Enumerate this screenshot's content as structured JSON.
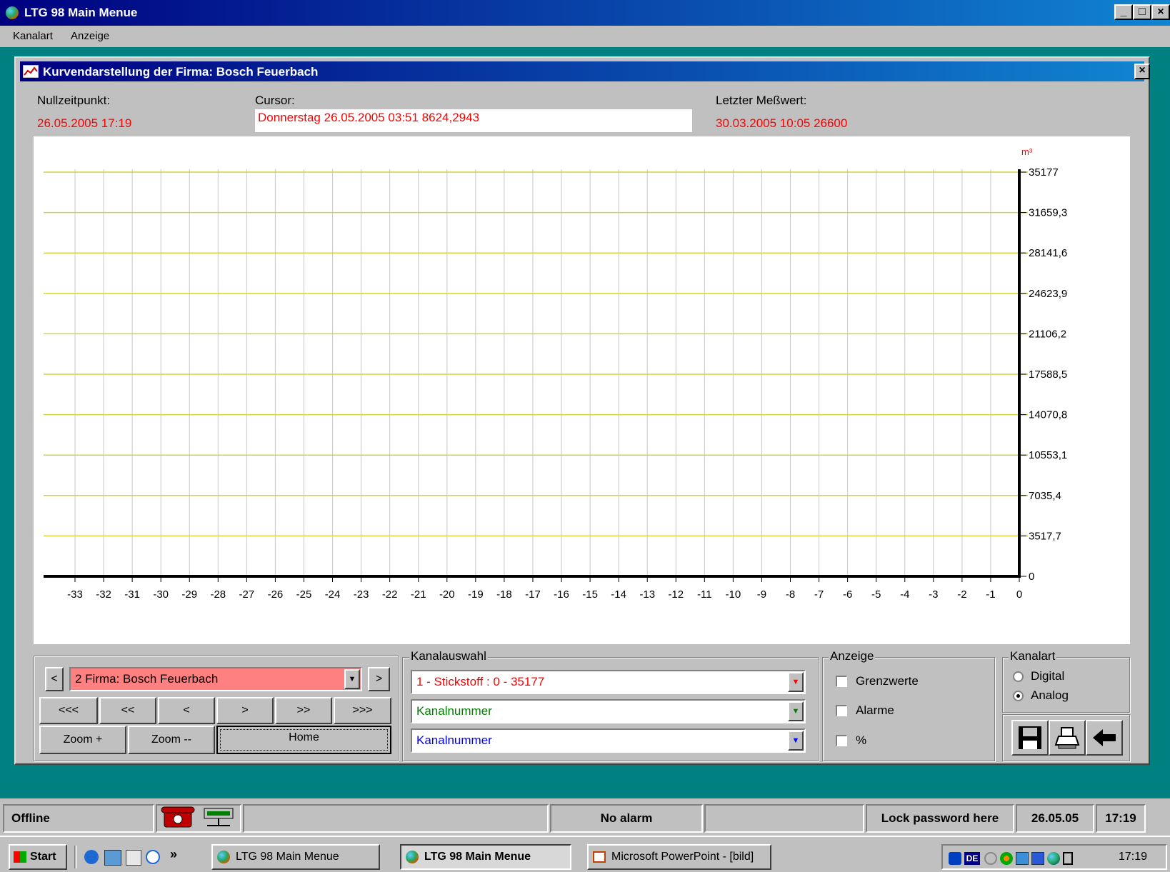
{
  "window": {
    "title": "LTG 98   Main Menue"
  },
  "menu": [
    "Kanalart",
    "Anzeige"
  ],
  "child": {
    "title": "Kurvendarstellung der Firma:  Bosch Feuerbach",
    "nullzeit_label": "Nullzeitpunkt:",
    "nullzeit_value": "26.05.2005 17:19",
    "cursor_label": "Cursor:",
    "cursor_value": "Donnerstag 26.05.2005 03:51     8624,2943",
    "letzter_label": "Letzter Meßwert:",
    "letzter_value": "30.03.2005 10:05    26600"
  },
  "chart_data": {
    "type": "line",
    "unit": "m³",
    "x": [
      -33,
      -32,
      -31,
      -30,
      -29,
      -28,
      -27,
      -26,
      -25,
      -24,
      -23,
      -22,
      -21,
      -20,
      -19,
      -18,
      -17,
      -16,
      -15,
      -14,
      -13,
      -12,
      -11,
      -10,
      -9,
      -8,
      -7,
      -6,
      -5,
      -4,
      -3,
      -2,
      -1,
      0
    ],
    "yticks": [
      "35177",
      "31659,3",
      "28141,6",
      "24623,9",
      "21106,2",
      "17588,5",
      "14070,8",
      "10553,1",
      "7035,4",
      "3517,7",
      "0"
    ],
    "ylim": [
      0,
      35177
    ],
    "series": [],
    "grid": true,
    "colors": {
      "major_grid": "#d4d440",
      "minor_grid": "#c8c8c8",
      "axis": "#000000",
      "unit": "#ff0000"
    }
  },
  "controls": {
    "firma_value": "2  Firma:  Bosch Feuerbach",
    "prev": "<",
    "next": ">",
    "nav": [
      "<<<",
      "<<",
      "<",
      ">",
      ">>",
      ">>>"
    ],
    "zoom_in": "Zoom +",
    "zoom_out": "Zoom --",
    "home": "Home",
    "kanalauswahl_title": "Kanalauswahl",
    "kanal1": "1 - Stickstoff  :  0 - 35177",
    "kanal2": "Kanalnummer",
    "kanal3": "Kanalnummer",
    "anzeige_title": "Anzeige",
    "grenzwerte": "Grenzwerte",
    "alarme": "Alarme",
    "prozent": "%",
    "kanalart_title": "Kanalart",
    "digital": "Digital",
    "analog": "Analog"
  },
  "status": {
    "offline": "Offline",
    "no_alarm": "No alarm",
    "lock": "Lock password here",
    "date": "26.05.05",
    "time": "17:19"
  },
  "taskbar": {
    "start": "Start",
    "chevron": "»",
    "btn1": "LTG 98   Main Menue",
    "btn2": "LTG 98   Main Menue",
    "btn3": "Microsoft PowerPoint - [bild]",
    "tray_lang": "DE",
    "clock": "17:19"
  }
}
